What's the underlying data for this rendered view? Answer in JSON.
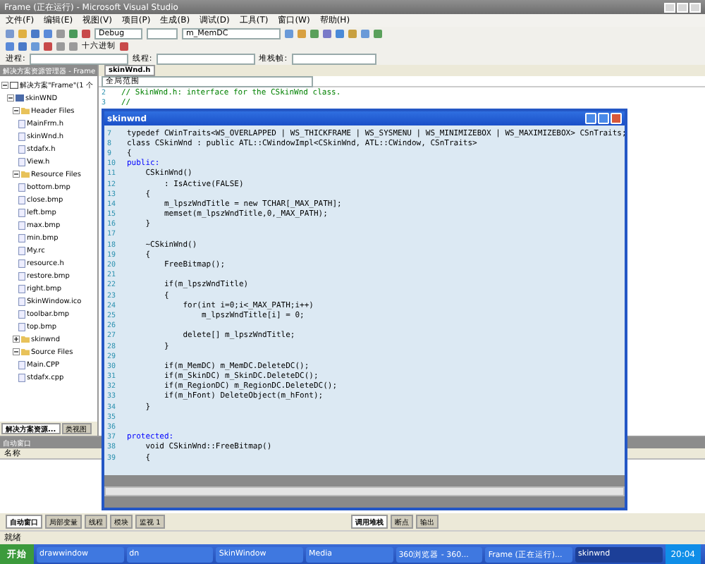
{
  "window": {
    "title": "Frame (正在运行) - Microsoft Visual Studio"
  },
  "menu": [
    "文件(F)",
    "编辑(E)",
    "视图(V)",
    "项目(P)",
    "生成(B)",
    "调试(D)",
    "工具(T)",
    "窗口(W)",
    "帮助(H)"
  ],
  "toolbar": {
    "config": "Debug",
    "find": "m_MemDC",
    "hex": "十六进制",
    "process_label": "进程:",
    "thread_label": "线程:",
    "frame_label": "堆栈帧:"
  },
  "solution_explorer": {
    "title": "解决方案资源管理器 - Frame",
    "tree": [
      {
        "label": "解决方案\"Frame\"(1 个",
        "kind": "solution",
        "expanded": true,
        "children": [
          {
            "label": "skinWND",
            "kind": "project",
            "expanded": true,
            "children": [
              {
                "label": "Header Files",
                "kind": "folder",
                "expanded": true,
                "children": [
                  {
                    "label": "MainFrm.h",
                    "kind": "file"
                  },
                  {
                    "label": "skinWnd.h",
                    "kind": "file"
                  },
                  {
                    "label": "stdafx.h",
                    "kind": "file"
                  },
                  {
                    "label": "View.h",
                    "kind": "file"
                  }
                ]
              },
              {
                "label": "Resource Files",
                "kind": "folder",
                "expanded": true,
                "children": [
                  {
                    "label": "bottom.bmp",
                    "kind": "file"
                  },
                  {
                    "label": "close.bmp",
                    "kind": "file"
                  },
                  {
                    "label": "left.bmp",
                    "kind": "file"
                  },
                  {
                    "label": "max.bmp",
                    "kind": "file"
                  },
                  {
                    "label": "min.bmp",
                    "kind": "file"
                  },
                  {
                    "label": "My.rc",
                    "kind": "file"
                  },
                  {
                    "label": "resource.h",
                    "kind": "file"
                  },
                  {
                    "label": "restore.bmp",
                    "kind": "file"
                  },
                  {
                    "label": "right.bmp",
                    "kind": "file"
                  },
                  {
                    "label": "SkinWindow.ico",
                    "kind": "file"
                  },
                  {
                    "label": "toolbar.bmp",
                    "kind": "file"
                  },
                  {
                    "label": "top.bmp",
                    "kind": "file"
                  }
                ]
              },
              {
                "label": "skinwnd",
                "kind": "folder",
                "expanded": false
              },
              {
                "label": "Source Files",
                "kind": "folder",
                "expanded": true,
                "children": [
                  {
                    "label": "Main.CPP",
                    "kind": "file"
                  },
                  {
                    "label": "stdafx.cpp",
                    "kind": "file"
                  }
                ]
              }
            ]
          }
        ]
      }
    ],
    "tabs": [
      {
        "label": "解决方案资源...",
        "selected": true
      },
      {
        "label": "类视图",
        "selected": false
      }
    ]
  },
  "editor": {
    "tab": "skinWnd.h",
    "scope": "全局范围",
    "lines": [
      {
        "num": "2",
        "text": "// SkinWnd.h: interface for the CSkinWnd class.",
        "kind": "comment"
      },
      {
        "num": "3",
        "text": "//",
        "kind": "comment"
      }
    ]
  },
  "skin_window": {
    "title": "skinwnd",
    "lines": [
      {
        "num": "7",
        "text": "typedef CWinTraits<WS_OVERLAPPED | WS_THICKFRAME | WS_SYSMENU | WS_MINIMIZEBOX | WS_MAXIMIZEBOX> CSnTraits;",
        "kind": "code"
      },
      {
        "num": "8",
        "text": "class CSkinWnd : public ATL::CWindowImpl<CSkinWnd, ATL::CWindow, CSnTraits>",
        "kind": "code"
      },
      {
        "num": "9",
        "text": "{",
        "kind": "code"
      },
      {
        "num": "10",
        "text": "public:",
        "kind": "keyword"
      },
      {
        "num": "11",
        "text": "    CSkinWnd()",
        "kind": "code"
      },
      {
        "num": "12",
        "text": "        : IsActive(FALSE)",
        "kind": "code"
      },
      {
        "num": "13",
        "text": "    {",
        "kind": "code"
      },
      {
        "num": "14",
        "text": "        m_lpszWndTitle = new TCHAR[_MAX_PATH];",
        "kind": "code"
      },
      {
        "num": "15",
        "text": "        memset(m_lpszWndTitle,0,_MAX_PATH);",
        "kind": "code"
      },
      {
        "num": "16",
        "text": "    }",
        "kind": "code"
      },
      {
        "num": "17"
      },
      {
        "num": "18",
        "text": "    ~CSkinWnd()",
        "kind": "code"
      },
      {
        "num": "19",
        "text": "    {",
        "kind": "code"
      },
      {
        "num": "20",
        "text": "        FreeBitmap();",
        "kind": "code"
      },
      {
        "num": "21"
      },
      {
        "num": "22",
        "text": "        if(m_lpszWndTitle)",
        "kind": "code"
      },
      {
        "num": "23",
        "text": "        {",
        "kind": "code"
      },
      {
        "num": "24",
        "text": "            for(int i=0;i<_MAX_PATH;i++)",
        "kind": "code"
      },
      {
        "num": "25",
        "text": "                m_lpszWndTitle[i] = 0;",
        "kind": "code"
      },
      {
        "num": "26"
      },
      {
        "num": "27",
        "text": "            delete[] m_lpszWndTitle;",
        "kind": "code"
      },
      {
        "num": "28",
        "text": "        }",
        "kind": "code"
      },
      {
        "num": "29"
      },
      {
        "num": "30",
        "text": "        if(m_MemDC) m_MemDC.DeleteDC();",
        "kind": "code"
      },
      {
        "num": "31",
        "text": "        if(m_SkinDC) m_SkinDC.DeleteDC();",
        "kind": "code"
      },
      {
        "num": "32",
        "text": "        if(m_RegionDC) m_RegionDC.DeleteDC();",
        "kind": "code"
      },
      {
        "num": "33",
        "text": "        if(m_hFont) DeleteObject(m_hFont);",
        "kind": "code"
      },
      {
        "num": "34",
        "text": "    }",
        "kind": "code"
      },
      {
        "num": "35"
      },
      {
        "num": "36"
      },
      {
        "num": "37",
        "text": "protected:",
        "kind": "keyword"
      },
      {
        "num": "38",
        "text": "    void CSkinWnd::FreeBitmap()",
        "kind": "code"
      },
      {
        "num": "39",
        "text": "    {",
        "kind": "code"
      }
    ]
  },
  "auto_window": {
    "title": "自动窗口",
    "columns": [
      "名称"
    ]
  },
  "bottom_tabs_left": [
    {
      "label": "自动窗口",
      "selected": true
    },
    {
      "label": "局部变量",
      "selected": false
    },
    {
      "label": "线程",
      "selected": false
    },
    {
      "label": "模块",
      "selected": false
    },
    {
      "label": "监视 1",
      "selected": false
    }
  ],
  "bottom_tabs_right": [
    {
      "label": "调用堆栈",
      "selected": true
    },
    {
      "label": "断点",
      "selected": false
    },
    {
      "label": "输出",
      "selected": false
    }
  ],
  "status_bar": "就绪",
  "taskbar": {
    "start": "开始",
    "items": [
      {
        "label": "drawwindow",
        "selected": false
      },
      {
        "label": "dn",
        "selected": false
      },
      {
        "label": "SkinWindow",
        "selected": false
      },
      {
        "label": "Media",
        "selected": false
      },
      {
        "label": "360浏览器 - 360...",
        "selected": false
      },
      {
        "label": "Frame (正在运行)...",
        "selected": false
      },
      {
        "label": "skinwnd",
        "selected": true
      }
    ],
    "clock": "20:04"
  }
}
